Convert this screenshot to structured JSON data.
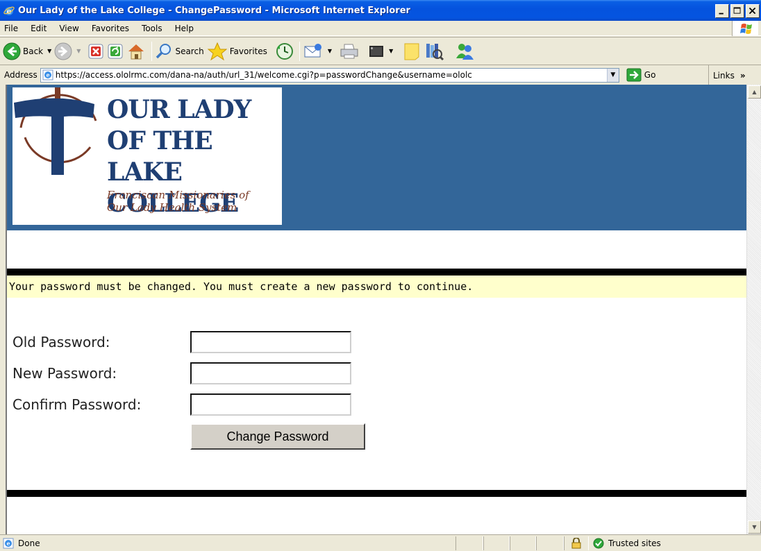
{
  "window": {
    "title": "Our Lady of the Lake College - ChangePassword - Microsoft Internet Explorer"
  },
  "menu": [
    "File",
    "Edit",
    "View",
    "Favorites",
    "Tools",
    "Help"
  ],
  "toolbar": {
    "back_label": "Back",
    "search_label": "Search",
    "favorites_label": "Favorites"
  },
  "address": {
    "label": "Address",
    "url": "https://access.ololrmc.com/dana-na/auth/url_31/welcome.cgi?p=passwordChange&username=ololc",
    "go_label": "Go",
    "links_label": "Links"
  },
  "logo": {
    "line1": "OUR LADY",
    "line2": "OF THE LAKE",
    "line3": "COLLEGE",
    "sub1": "Franciscan Missionaries of",
    "sub2": "Our Lady Health System"
  },
  "page": {
    "notice": "Your password must be changed. You must create a new password to continue.",
    "old_label": "Old Password:",
    "new_label": "New Password:",
    "confirm_label": "Confirm Password:",
    "old_value": "",
    "new_value": "",
    "confirm_value": "",
    "submit_label": "Change Password"
  },
  "status": {
    "text": "Done",
    "zone": "Trusted sites"
  },
  "colors": {
    "header_band": "#336699",
    "notice_bg": "#ffffcc",
    "titlebar": "#0553de",
    "logo_navy": "#1f3f73",
    "logo_brown": "#7a3a26"
  }
}
